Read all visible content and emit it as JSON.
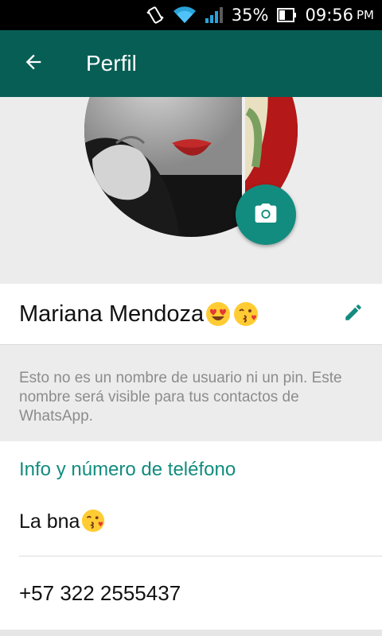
{
  "status_bar": {
    "battery_percent": "35%",
    "time": "09:56",
    "ampm": "PM",
    "icons": [
      "vibrate-icon",
      "wifi-icon",
      "signal-icon",
      "battery-icon"
    ]
  },
  "app_bar": {
    "title": "Perfil",
    "back_icon": "arrow-back-icon",
    "color": "#075e54"
  },
  "profile": {
    "camera_icon": "camera-icon",
    "name": "Mariana Mendoza",
    "name_emojis": [
      "heart-eyes-emoji",
      "kissing-heart-emoji"
    ],
    "edit_icon": "pencil-icon",
    "name_hint": "Esto no es un nombre de usuario ni un pin. Este nombre será visible para tus contactos de WhatsApp."
  },
  "info": {
    "section_title": "Info y número de teléfono",
    "about": "La bna",
    "about_emoji": "kissing-heart-emoji",
    "phone": "+57 322 2555437",
    "accent_color": "#128c7e"
  }
}
